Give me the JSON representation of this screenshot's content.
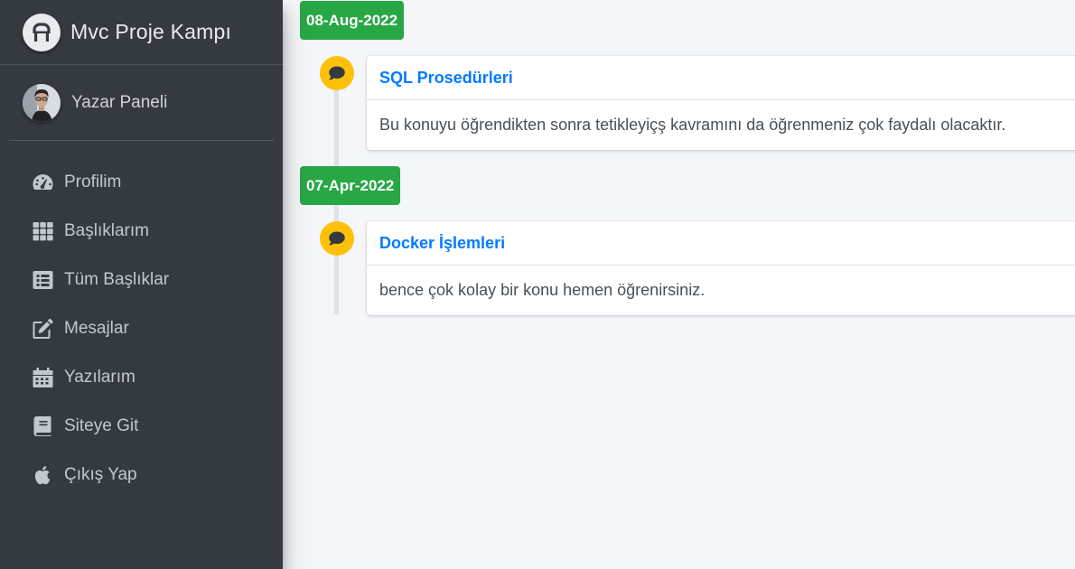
{
  "brand": {
    "title": "Mvc Proje Kampı",
    "logo_icon": "a-letter-logo-icon"
  },
  "user": {
    "name": "Yazar Paneli"
  },
  "nav": [
    {
      "label": "Profilim",
      "icon": "tachometer-icon"
    },
    {
      "label": "Başlıklarım",
      "icon": "grid-icon"
    },
    {
      "label": "Tüm Başlıklar",
      "icon": "list-icon"
    },
    {
      "label": "Mesajlar",
      "icon": "edit-icon"
    },
    {
      "label": "Yazılarım",
      "icon": "calendar-icon"
    },
    {
      "label": "Siteye Git",
      "icon": "book-icon"
    },
    {
      "label": "Çıkış Yap",
      "icon": "apple-icon"
    }
  ],
  "timeline": [
    {
      "date": "08-Aug-2022",
      "title": "SQL Prosedürleri",
      "body": "Bu konuyu öğrendikten sonra tetikleyiçş kavramını da öğrenmeniz çok faydalı olacaktır.",
      "icon": "comment-icon"
    },
    {
      "date": "07-Apr-2022",
      "title": "Docker İşlemleri",
      "body": "bence çok kolay bir konu hemen öğrenirsiniz.",
      "icon": "comment-icon"
    }
  ],
  "colors": {
    "sidebar": "#343a40",
    "date_label": "#28a745",
    "timeline_icon": "#ffc107",
    "link": "#007bff"
  }
}
